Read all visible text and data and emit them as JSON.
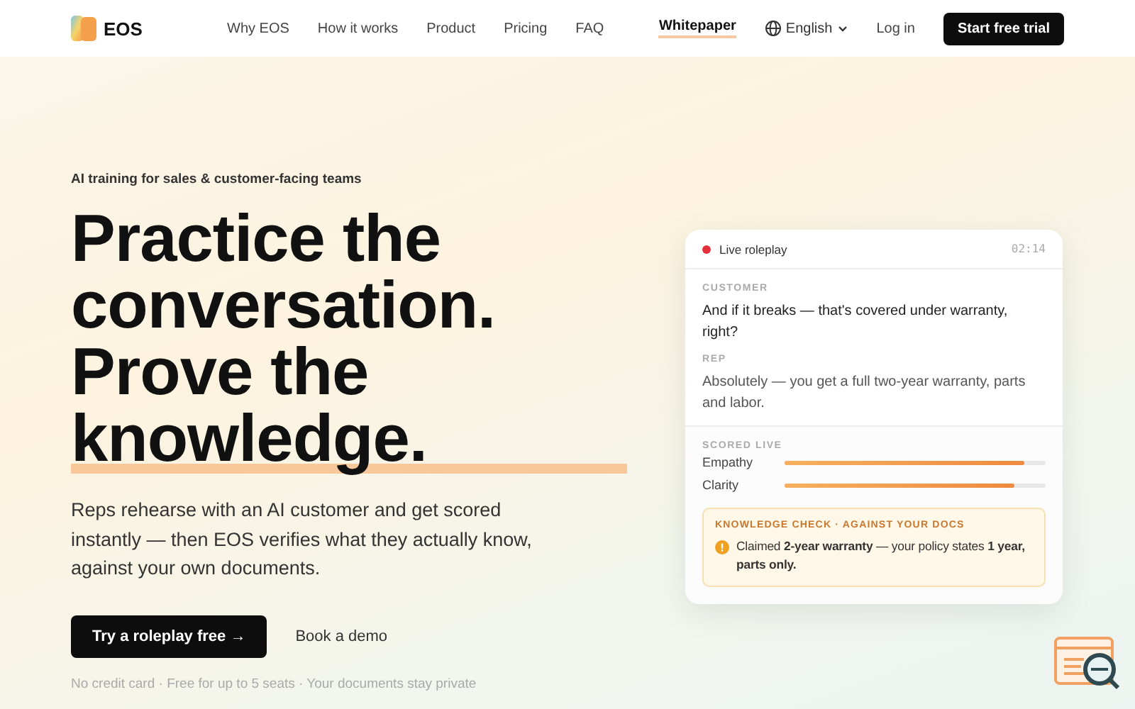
{
  "nav": {
    "brand": "EOS",
    "links": [
      "Why EOS",
      "How it works",
      "Product",
      "Pricing",
      "FAQ"
    ],
    "whitepaper": "Whitepaper",
    "language": "English",
    "login": "Log in",
    "cta": "Start free trial"
  },
  "hero": {
    "eyebrow": "AI training for sales & customer-facing teams",
    "headline": [
      "Practice the",
      "conversation.",
      "Prove the",
      "knowledge."
    ],
    "lead": "Reps rehearse with an AI customer and get scored instantly — then EOS verifies what they actually know, against your own documents.",
    "primary": "Try a roleplay free →",
    "secondary": "Book a demo",
    "note": "No credit card · Free for up to 5 seats · Your documents stay private"
  },
  "card": {
    "title": "Live roleplay",
    "timer": "02:14",
    "turns": [
      {
        "speaker": "CUSTOMER",
        "text": "And if it breaks — that's covered under warranty, right?"
      },
      {
        "speaker": "REP",
        "text": "Absolutely — you get a full two-year warranty, parts and labor."
      }
    ],
    "scored_label": "SCORED LIVE",
    "metrics": [
      {
        "name": "Empathy",
        "level": 0.92
      },
      {
        "name": "Clarity",
        "level": 0.88
      }
    ],
    "check": {
      "title": "KNOWLEDGE CHECK · AGAINST YOUR DOCS",
      "text": "Claimed **2-year warranty** — your policy states **1 year, parts only.**"
    }
  }
}
